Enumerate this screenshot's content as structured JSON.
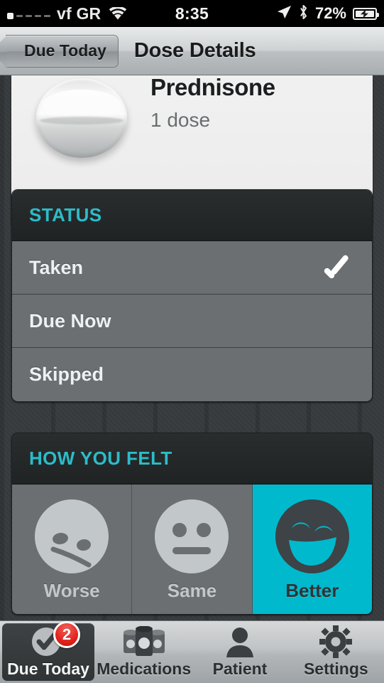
{
  "status_bar": {
    "carrier": "vf GR",
    "wifi_icon": "wifi-icon",
    "time": "8:35",
    "location_icon": "location-arrow-icon",
    "bluetooth_icon": "bluetooth-icon",
    "battery_percent": "72%",
    "battery_icon": "battery-charging-icon",
    "signal_bars_filled": 1,
    "signal_bars_total": 5
  },
  "nav_bar": {
    "back_label": "Due Today",
    "title": "Dose Details"
  },
  "medication": {
    "name": "Prednisone",
    "dose": "1 dose",
    "pill_icon": "round-tablet-pill-icon"
  },
  "status_section": {
    "header": "STATUS",
    "options": [
      {
        "label": "Taken",
        "selected": true
      },
      {
        "label": "Due Now",
        "selected": false
      },
      {
        "label": "Skipped",
        "selected": false
      }
    ]
  },
  "mood_section": {
    "header": "HOW YOU FELT",
    "options": [
      {
        "label": "Worse",
        "icon": "sad-face-icon",
        "selected": false
      },
      {
        "label": "Same",
        "icon": "neutral-face-icon",
        "selected": false
      },
      {
        "label": "Better",
        "icon": "happy-face-icon",
        "selected": true
      }
    ]
  },
  "tab_bar": {
    "tabs": [
      {
        "label": "Due Today",
        "icon": "check-circle-icon",
        "badge": "2",
        "active": true
      },
      {
        "label": "Medications",
        "icon": "pill-bottles-icon",
        "badge": "",
        "active": false
      },
      {
        "label": "Patient",
        "icon": "person-icon",
        "badge": "",
        "active": false
      },
      {
        "label": "Settings",
        "icon": "gear-icon",
        "badge": "",
        "active": false
      }
    ]
  },
  "colors": {
    "accent_cyan": "#00b9cd",
    "header_text_cyan": "#2cbcc9",
    "badge_red": "#e2231d",
    "row_grey": "#6b6f72",
    "background": "#34383a"
  }
}
